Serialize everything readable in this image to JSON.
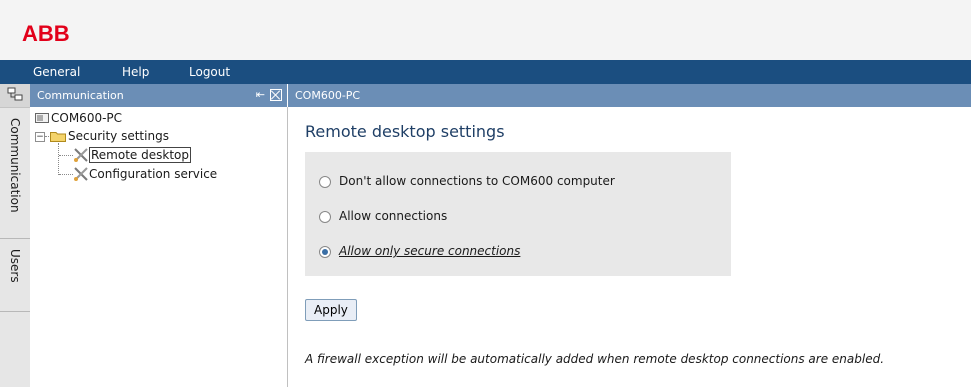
{
  "brand": {
    "logo_text": "ABB",
    "color": "#e2001a"
  },
  "menu": {
    "items": [
      "General",
      "Help",
      "Logout"
    ]
  },
  "left_tabs": [
    "Communication",
    "Users"
  ],
  "tree_panel": {
    "title": "Communication",
    "icons": [
      "pin-icon",
      "close-icon"
    ],
    "tree": {
      "root": "COM600-PC",
      "folder": "Security settings",
      "children": [
        "Remote desktop",
        "Configuration service"
      ],
      "selected": "Remote desktop"
    }
  },
  "main": {
    "header": "COM600-PC",
    "section_title": "Remote desktop settings",
    "options": [
      {
        "label": "Don't allow connections to COM600 computer",
        "checked": false
      },
      {
        "label": "Allow connections",
        "checked": false
      },
      {
        "label": "Allow only secure connections",
        "checked": true
      }
    ],
    "apply_label": "Apply",
    "note": "A firewall exception will be automatically added when remote desktop connections are enabled."
  },
  "colors": {
    "menubar": "#1b4e80",
    "panel_header": "#6b8eb6",
    "options_bg": "#e8e8e8"
  }
}
